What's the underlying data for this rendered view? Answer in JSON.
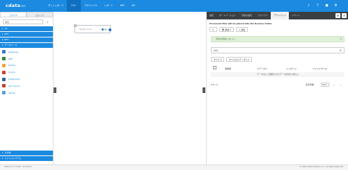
{
  "header": {
    "brand": "cdata",
    "brand_sub": "arc",
    "nav": [
      "ダッシュボード",
      "フロー",
      "プロファイル",
      "レポート",
      "MFT",
      "API"
    ],
    "active_nav": 1,
    "icons": [
      "bell-icon",
      "help-icon",
      "user-icon",
      "settings-icon"
    ]
  },
  "sidebar": {
    "tabs": [
      "コネクタ",
      "ロジック"
    ],
    "search_placeholder": "検索",
    "categories_top": [
      "AS",
      "MFT",
      "EDI"
    ],
    "database_category": "データベース",
    "connectors": [
      {
        "label": "Database",
        "color": "#2e7bc4"
      },
      {
        "label": "DB2",
        "color": "#2e8b2e"
      },
      {
        "label": "MySQL",
        "color": "#f0a23c"
      },
      {
        "label": "Oracle",
        "color": "#d83b2c"
      },
      {
        "label": "PostgreSQL",
        "color": "#336791"
      },
      {
        "label": "SQL Server",
        "color": "#c33c2f"
      },
      {
        "label": "SQLite",
        "color": "#5a9fd4"
      }
    ],
    "categories_bottom": [
      "その他",
      "ファイルシステム"
    ]
  },
  "canvas": {
    "node_label": "MySQL_Conn"
  },
  "panel": {
    "tabs": [
      "設定",
      "オートメーション",
      "高度な設定",
      "スクリプト",
      "アウトプット",
      "イベント"
    ],
    "active_tab": 4,
    "message": "Processed files will be placed into the Receive folder.",
    "toolbar": {
      "refresh": "⟳",
      "delete": "削除",
      "upload": "送信"
    },
    "alert": "有効な受信しました。",
    "search_placeholder": "検索...",
    "filters": [
      "すべて",
      "すべてのステータス"
    ],
    "columns": [
      "送信者",
      "ステータス",
      "メッセージ",
      "ファイルサイズ"
    ],
    "empty_text": "データなしで選択されたデータがありません",
    "pager_count": "0-0 / 0",
    "per_page_label": "表示件数",
    "per_page_value": "50"
  },
  "footer": {
    "left": "CData Arc © 2022 - 22.0.8173",
    "right": "© 2022 CData Software, Inc. All Rights Reserved."
  }
}
